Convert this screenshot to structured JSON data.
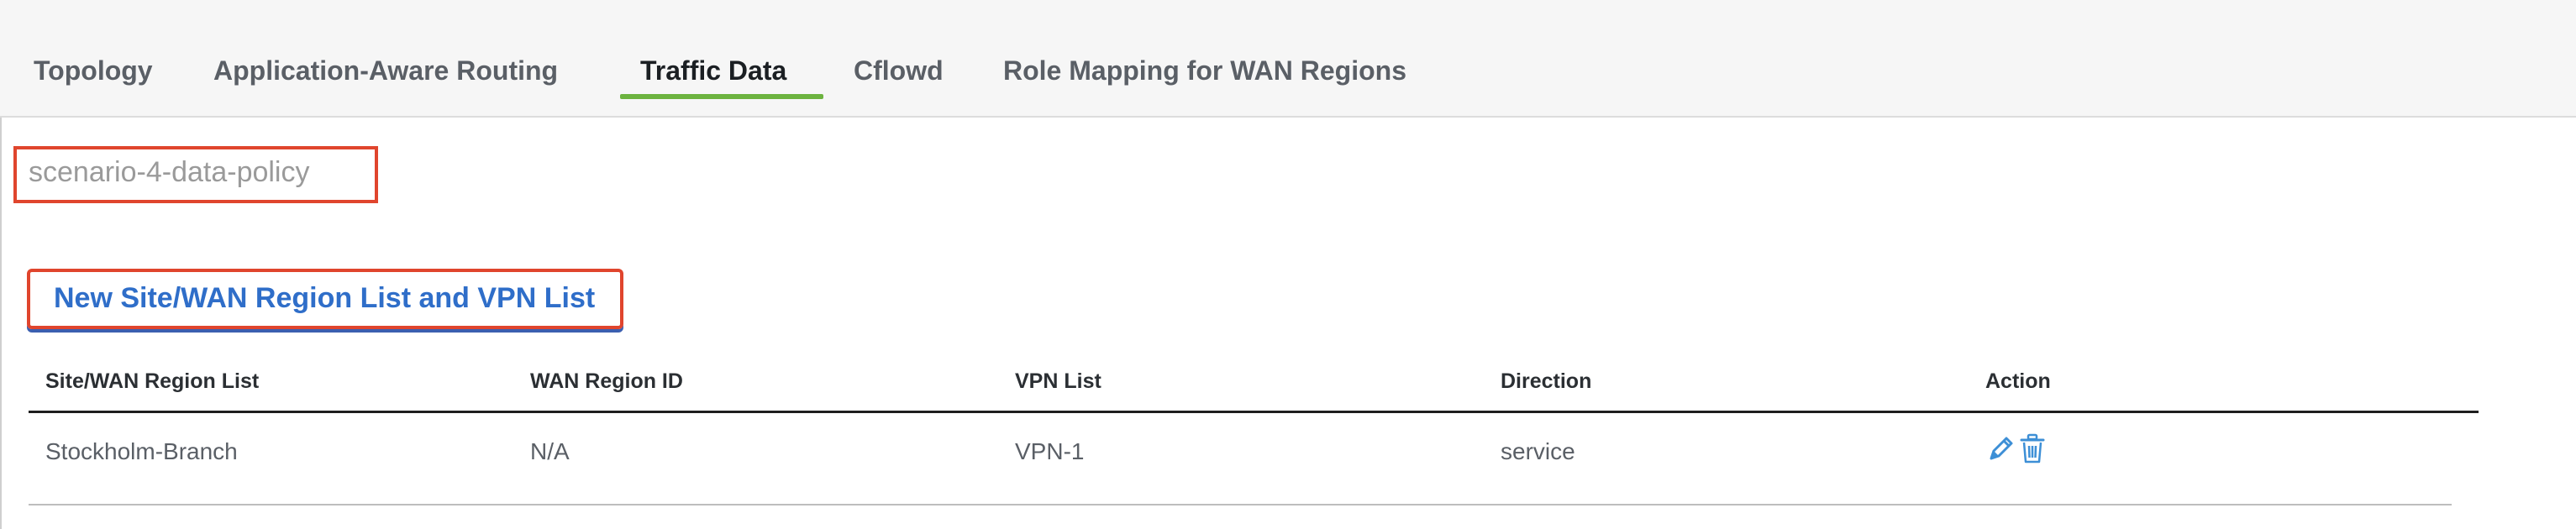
{
  "tabs": [
    {
      "label": "Topology"
    },
    {
      "label": "Application-Aware Routing"
    },
    {
      "label": "Traffic Data"
    },
    {
      "label": "Cflowd"
    },
    {
      "label": "Role Mapping for WAN Regions"
    }
  ],
  "active_tab": "Traffic Data",
  "policy": {
    "name": "scenario-4-data-policy"
  },
  "new_list_button": {
    "label": "New Site/WAN Region List and VPN List"
  },
  "table": {
    "columns": [
      "Site/WAN Region List",
      "WAN Region ID",
      "VPN List",
      "Direction",
      "Action"
    ],
    "rows": [
      {
        "site_list": "Stockholm-Branch",
        "wan_region_id": "N/A",
        "vpn_list": "VPN-1",
        "direction": "service"
      }
    ]
  },
  "icons": {
    "edit": "pencil-icon",
    "delete": "trash-icon"
  },
  "colors": {
    "accent_green": "#6cb33f",
    "link_blue": "#2f6ec9",
    "highlight_red": "#e0452d"
  }
}
